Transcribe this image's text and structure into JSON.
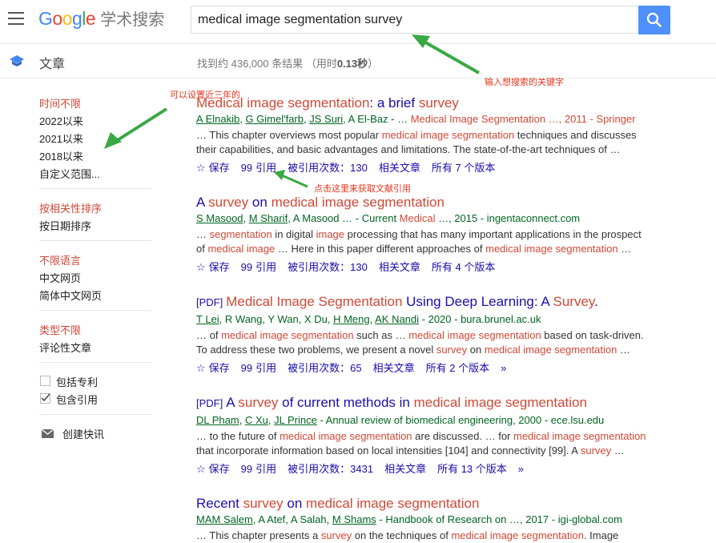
{
  "header": {
    "logo_text": "Google",
    "logo_suffix": "学术搜索",
    "search_value": "medical image segmentation survey"
  },
  "subheader": {
    "section_label": "文章",
    "result_stats_prefix": "找到约 436,000 条结果 （用时",
    "result_stats_time": "0.13秒",
    "result_stats_suffix": "）"
  },
  "sidebar": {
    "time_header": "时间不限",
    "time_options": [
      "2022以来",
      "2021以来",
      "2018以来",
      "自定义范围..."
    ],
    "sort_header": "按相关性排序",
    "sort_option": "按日期排序",
    "lang_header": "不限语言",
    "lang_options": [
      "中文网页",
      "简体中文网页"
    ],
    "type_header": "类型不限",
    "type_option": "评论性文章",
    "include_patents": "包括专利",
    "include_citations": "包含引用",
    "create_alert": "创建快讯"
  },
  "results": [
    {
      "title_a": "Medical image segmentation",
      "title_b": ": a brief ",
      "title_c": "survey",
      "meta": [
        "A Elnakib",
        "G Gimel'farb",
        "JS Suri",
        "A El-Baz",
        "Medical Image Segmentation …, 2011 - Springer"
      ],
      "snippet1": [
        "… This chapter overviews most popular ",
        "medical image segmentation",
        " techniques and discusses"
      ],
      "snippet2": "their capabilities, and basic advantages and limitations. The state-of-the-art techniques of …",
      "save": "保存",
      "cite": "引用",
      "cited_by": "被引用次数：130",
      "related": "相关文章",
      "versions": "所有 7 个版本"
    },
    {
      "title_a": "A ",
      "title_b": "survey",
      "title_c": " on ",
      "title_d": "medical image segmentation",
      "meta": [
        "S Masood",
        "M Sharif",
        "A Masood",
        "Current ",
        "Medical",
        " …, 2015 - ingentaconnect.com"
      ],
      "snippet1": [
        "… ",
        "segmentation",
        " in digital ",
        "image",
        " processing that has many important applications in the prospect"
      ],
      "snippet2": [
        "of ",
        "medical image",
        " … Here in this paper different approaches of ",
        "medical image segmentation",
        " …"
      ],
      "save": "保存",
      "cite": "引用",
      "cited_by": "被引用次数：130",
      "related": "相关文章",
      "versions": "所有 4 个版本"
    },
    {
      "pdf": "[PDF]",
      "title_a": "Medical Image Segmentation",
      "title_b": " Using Deep Learning: A ",
      "title_c": "Survey",
      "title_d": ".",
      "meta": [
        "T Lei",
        "R Wang",
        "Y Wan",
        "X Du",
        "H Meng",
        "AK Nandi",
        "- 2020 - bura.brunel.ac.uk"
      ],
      "snippet1": [
        "… of ",
        "medical image segmentation",
        " such as … ",
        "medical image segmentation",
        " based on task-driven."
      ],
      "snippet2": [
        "To address these two problems, we present a novel ",
        "survey",
        " on ",
        "medical image segmentation",
        " …"
      ],
      "save": "保存",
      "cite": "引用",
      "cited_by": "被引用次数：65",
      "related": "相关文章",
      "versions": "所有 2 个版本"
    },
    {
      "pdf": "[PDF]",
      "title_a": "A ",
      "title_b": "survey",
      "title_c": " of current methods in ",
      "title_d": "medical image segmentation",
      "meta": [
        "DL Pham",
        "C Xu",
        "JL Prince",
        "- Annual review of biomedical engineering, 2000 - ece.lsu.edu"
      ],
      "snippet1": [
        "… to the future of ",
        "medical image segmentation",
        " are discussed. … for ",
        "medical image segmentation"
      ],
      "snippet2": [
        "that incorporate information based on local intensities [104] and connectivity [99]. A ",
        "survey",
        " …"
      ],
      "save": "保存",
      "cite": "引用",
      "cited_by": "被引用次数：3431",
      "related": "相关文章",
      "versions": "所有 13 个版本"
    },
    {
      "title_a": "Recent ",
      "title_b": "survey",
      "title_c": " on ",
      "title_d": "medical image segmentation",
      "meta": [
        "MAM Salem",
        "A Atef",
        "A Salah",
        "M Shams",
        "- Handbook of Research on …, 2017 - igi-global.com"
      ],
      "snippet1": [
        "… This chapter presents a ",
        "survey",
        " on the techniques of ",
        "medical image segmentation",
        ". Image"
      ]
    }
  ],
  "annotations": {
    "keyword_note": "输入想搜索的关键字",
    "time_note": "可以设置近三年的",
    "cite_note": "点击这里来获取文献引用"
  },
  "colors": {
    "link": "#1a0dab",
    "highlight": "#d14836",
    "meta": "#006621",
    "annotation": "#e8341c",
    "arrow": "#3aa845",
    "search_button": "#4d90fe"
  }
}
